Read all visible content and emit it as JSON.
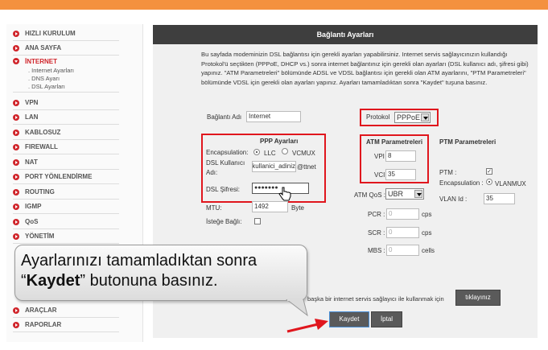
{
  "sidebar": {
    "items": [
      "HIZLI KURULUM",
      "ANA SAYFA",
      "İNTERNET",
      "VPN",
      "LAN",
      "KABLOSUZ",
      "FIREWALL",
      "NAT",
      "PORT YÖNLENDİRME",
      "ROUTING",
      "IGMP",
      "QoS",
      "YÖNETİM",
      "ARAÇLAR",
      "RAPORLAR"
    ],
    "subitems": [
      "Internet Ayarları",
      "DNS Ayarı",
      "DSL Ayarları"
    ]
  },
  "header": {
    "title": "Bağlantı Ayarları"
  },
  "description": "Bu sayfada modeminizin DSL bağlantısı için gerekli ayarları yapabilirsiniz. Internet servis sağlayıcınızın kullandığı Protokol'ü seçtikten (PPPoE, DHCP vs.) sonra internet bağlantınız için gerekli olan ayarları (DSL kullanıcı adı, şifresi gibi) yapınız. \"ATM Parametreleri\" bölümünde ADSL ve VDSL bağlantısı için gerekli olan ATM ayarlarını, \"PTM Parametreleri\" bölümünde VDSL için gerekli olan ayarları yapınız. Ayarları tamamladıktan sonra \"Kaydet\" tuşuna basınız.",
  "form": {
    "connection_name_label": "Bağlantı Adı",
    "connection_name": "Internet",
    "protocol_label": "Protokol",
    "protocol": "PPPoE",
    "ppp_title": "PPP Ayarları",
    "encap_label": "Encapsulation:",
    "llc": "LLC",
    "vcmux": "VCMUX",
    "user_label_1": "DSL Kullanıcı",
    "user_label_2": "Adı:",
    "username": "kullanici_adiniz",
    "domain": "@ttnet",
    "pass_label": "DSL Şifresi:",
    "password": "●●●●●●●",
    "mtu_label": "MTU:",
    "mtu": "1492",
    "mtu_unit": "Byte",
    "optional_label": "İsteğe Bağlı:",
    "atm_title": "ATM Parametreleri",
    "vpi_label": "VPI :",
    "vpi": "8",
    "vci_label": "VCI :",
    "vci": "35",
    "qos_label": "ATM QoS :",
    "qos": "UBR",
    "pcr_label": "PCR :",
    "pcr": "0",
    "scr_label": "SCR :",
    "scr": "0",
    "mbs_label": "MBS :",
    "mbs": "0",
    "cps": "cps",
    "cells": "cells",
    "ptm_title": "PTM Parametreleri",
    "ptm_label": "PTM :",
    "ptm_encap_label": "Encapsulation :",
    "vlanmux": "VLANMUX",
    "vlan_label": "VLAN Id :",
    "vlan": "35"
  },
  "other_isp_text": "başka bir internet servis sağlayıcı ile kullanmak için",
  "click_button": "tıklayınız",
  "save_button": "Kaydet",
  "cancel_button": "İptal",
  "callout": {
    "line1": "Ayarlarınızı tamamladıktan sonra",
    "quote_open": "“",
    "bold": "Kaydet",
    "line2_rest": "” butonuna basınız."
  },
  "colors": {
    "accent": "#f4913f",
    "highlight": "#e0161d",
    "nav_icon": "#d0252b"
  }
}
